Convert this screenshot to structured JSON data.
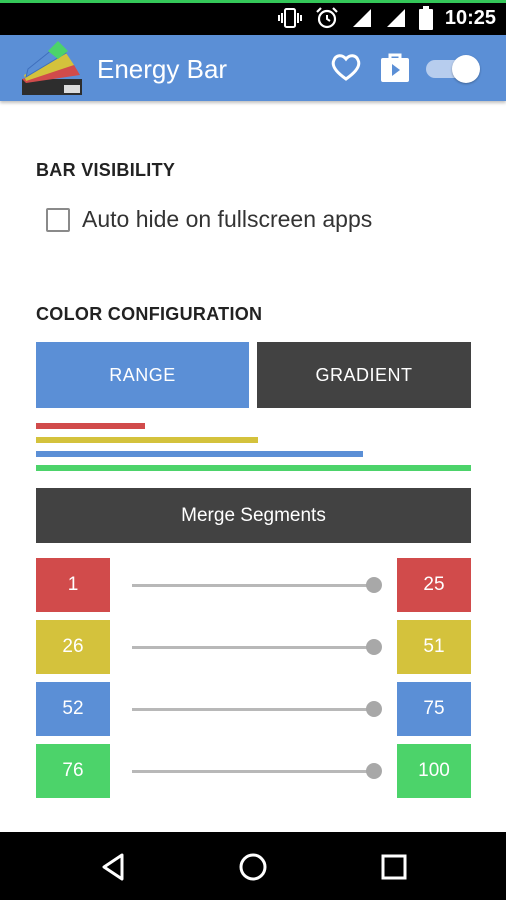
{
  "status_bar": {
    "time": "10:25",
    "icons": [
      "vibrate-icon",
      "alarm-icon",
      "signal-icon",
      "signal-icon",
      "battery-icon"
    ]
  },
  "app_bar": {
    "title": "Energy Bar",
    "icons": [
      "app-logo",
      "heart-icon",
      "store-icon",
      "toggle-switch"
    ],
    "toggle_on": true
  },
  "sections": {
    "visibility_title": "BAR VISIBILITY",
    "auto_hide_label": "Auto hide on fullscreen apps",
    "auto_hide_checked": false,
    "color_title": "COLOR CONFIGURATION"
  },
  "color_mode": {
    "range_label": "RANGE",
    "gradient_label": "GRADIENT",
    "selected": "RANGE"
  },
  "merge_label": "Merge Segments",
  "segments": [
    {
      "start": "1",
      "end": "25",
      "color": "#d14b4b"
    },
    {
      "start": "26",
      "end": "51",
      "color": "#d4c23c"
    },
    {
      "start": "52",
      "end": "75",
      "color": "#5b8fd6"
    },
    {
      "start": "76",
      "end": "100",
      "color": "#4cd36a"
    }
  ],
  "colors": {
    "accent": "#5b8fd6",
    "dark_button": "#424242",
    "red": "#d14b4b",
    "yellow": "#d4c23c",
    "blue": "#5b8fd6",
    "green": "#4cd36a"
  },
  "nav_bar": {
    "icons": [
      "back-icon",
      "home-icon",
      "recents-icon"
    ]
  }
}
